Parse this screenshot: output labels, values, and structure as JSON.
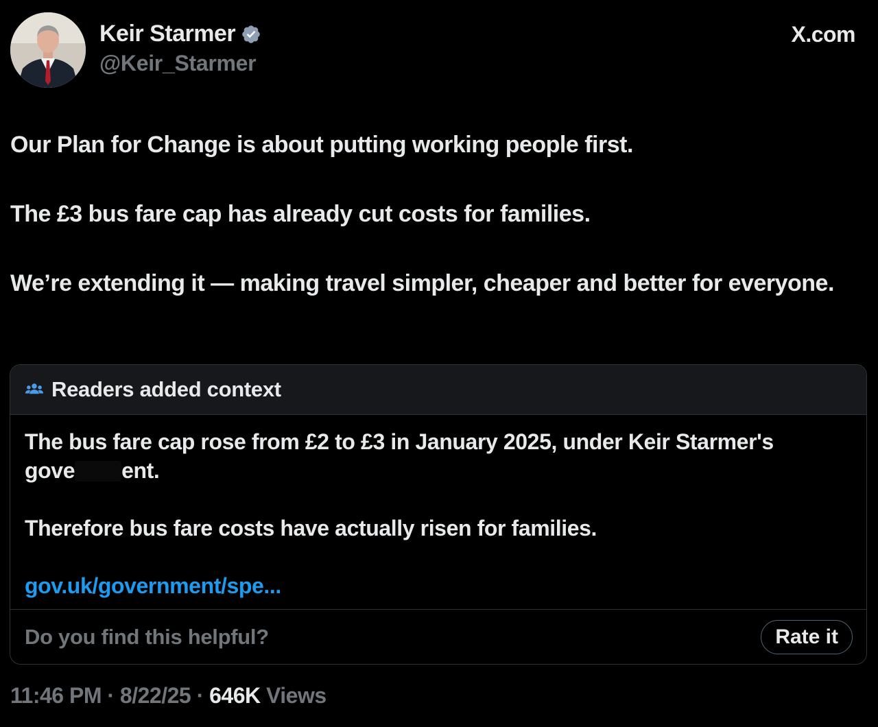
{
  "author": {
    "display_name": "Keir Starmer",
    "handle": "@Keir_Starmer",
    "verified_icon": "verified-badge-icon",
    "avatar": "profile-photo"
  },
  "site_label": "X.com",
  "tweet": {
    "paragraphs": [
      "Our Plan for Change is about putting working people first.",
      "The £3 bus fare cap has already cut costs for families.",
      "We’re extending it — making travel simpler, cheaper and better for everyone."
    ]
  },
  "community_note": {
    "header_icon": "people-icon",
    "header_label": "Readers added context",
    "text_line1_before": "The bus fare cap rose from £2 to £3 in January 2025, under Keir Starmer's gove",
    "text_line1_after": "ent.",
    "text_p2": "Therefore bus fare costs have actually risen for families.",
    "link": "gov.uk/government/spe...",
    "helpful_question": "Do you find this helpful?",
    "rate_button": "Rate it"
  },
  "meta": {
    "time": "11:46 PM",
    "sep1": " · ",
    "date": "8/22/25",
    "sep2": " · ",
    "views_count": "646K",
    "views_label": " Views"
  },
  "colors": {
    "background": "#000000",
    "text": "#e7e9ea",
    "muted": "#71767b",
    "link": "#1d9bf0",
    "verified": "#8e9fb4",
    "border": "#2f3336"
  }
}
